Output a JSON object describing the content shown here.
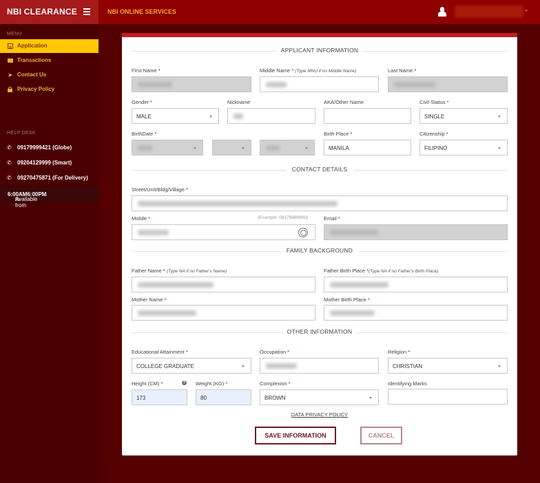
{
  "header": {
    "brand": "NBI CLEARANCE",
    "subtitle": "NBI ONLINE SERVICES",
    "menu_icon": "hamburger-icon",
    "user_icon": "user-icon"
  },
  "sidebar": {
    "menu_label": "MENU",
    "items": [
      {
        "label": "Application",
        "icon": "document-icon",
        "active": true
      },
      {
        "label": "Transactions",
        "icon": "credit-card-icon",
        "active": false
      },
      {
        "label": "Contact Us",
        "icon": "paper-plane-icon",
        "active": false
      },
      {
        "label": "Privacy Policy",
        "icon": "lock-icon",
        "active": false
      }
    ],
    "helpdesk_label": "HELP DESK",
    "phones": [
      {
        "label": "09179999421 (Globe)",
        "icon": "phone-icon"
      },
      {
        "label": "09204129999 (Smart)",
        "icon": "phone-icon"
      },
      {
        "label": "09270475871 (For Delivery)",
        "icon": "phone-icon"
      }
    ],
    "availability": {
      "prefix": "Available from ",
      "start": "6:00AM",
      "mid": " to ",
      "end": "6:00PM"
    }
  },
  "form": {
    "sections": {
      "applicant": "APPLICANT INFORMATION",
      "contact": "CONTACT DETAILS",
      "family": "FAMILY BACKGROUND",
      "other": "OTHER INFORMATION"
    },
    "fields": {
      "first_name": {
        "label": "First Name",
        "required": "*"
      },
      "middle_name": {
        "label": "Middle Name",
        "required": "*",
        "note": "(Type MNU if no Middle Name)"
      },
      "last_name": {
        "label": "Last Name",
        "required": "*"
      },
      "gender": {
        "label": "Gender",
        "required": "*",
        "value": "MALE"
      },
      "nickname": {
        "label": "Nickname"
      },
      "aka": {
        "label": "AKA/Other Name",
        "value": ""
      },
      "civil_status": {
        "label": "Civil Status",
        "required": "*",
        "value": "SINGLE"
      },
      "birthdate": {
        "label": "BirthDate",
        "required": "*"
      },
      "birth_place": {
        "label": "Birth Place",
        "required": "*",
        "value": "MANILA"
      },
      "citizenship": {
        "label": "Citizenship",
        "required": "*",
        "value": "FILIPINO"
      },
      "street": {
        "label": "Street/Unit/Bldg/Village",
        "required": "*"
      },
      "mobile": {
        "label": "Mobile",
        "required": "*",
        "hint": "(Example: 09178889900)"
      },
      "email": {
        "label": "Email",
        "required": "*"
      },
      "father_name": {
        "label": "Father Name",
        "required": "*",
        "note": "(Type NA if no Father's Name)"
      },
      "father_birth_place": {
        "label": "Father Birth Place",
        "required": "*",
        "note": "(Type NA if no Father's Birth Place)"
      },
      "mother_name": {
        "label": "Mother Name",
        "required": "*"
      },
      "mother_birth_place": {
        "label": "Mother Birth Place",
        "required": "*"
      },
      "education": {
        "label": "Educational Attainment",
        "required": "*",
        "value": "COLLEGE GRADUATE"
      },
      "occupation": {
        "label": "Occupation",
        "required": "*"
      },
      "religion": {
        "label": "Religion",
        "required": "*",
        "value": "CHRISTIAN"
      },
      "height": {
        "label": "Height (CM)",
        "required": "*",
        "value": "173",
        "help_icon": "question-circle-icon"
      },
      "weight": {
        "label": "Weight (KG)",
        "required": "*",
        "value": "80"
      },
      "complexion": {
        "label": "Complexion",
        "required": "*",
        "value": "BROWN"
      },
      "identifying_marks": {
        "label": "Identifying Marks",
        "value": ""
      }
    },
    "privacy_link": "DATA PRIVACY POLICY",
    "save_label": "SAVE INFORMATION",
    "cancel_label": "CANCEL"
  }
}
